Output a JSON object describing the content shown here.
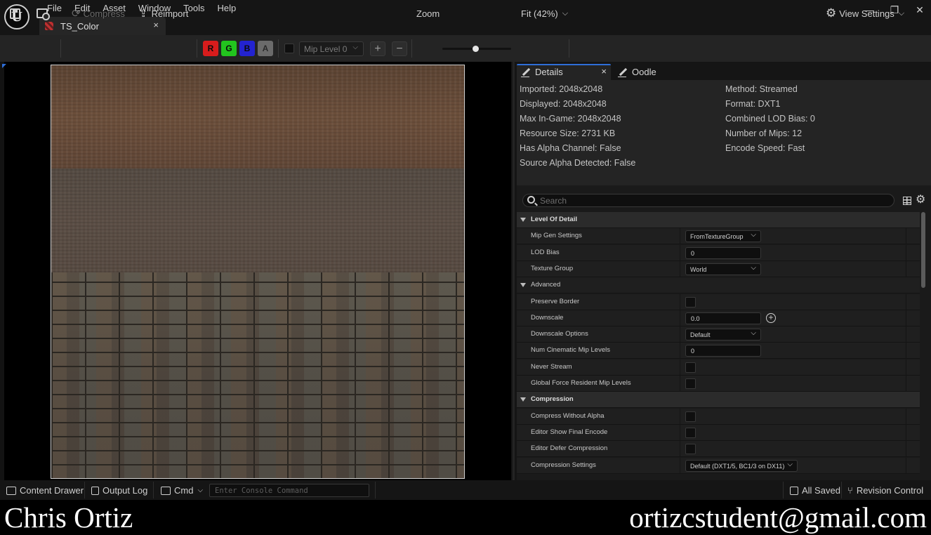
{
  "menu": [
    "File",
    "Edit",
    "Asset",
    "Window",
    "Tools",
    "Help"
  ],
  "document_tab": {
    "title": "TS_Color",
    "close": "×"
  },
  "window_controls": {
    "minimize": "—",
    "restore": "❐",
    "close": "✕"
  },
  "toolbar": {
    "compress_label": "Compress",
    "reimport_label": "Reimport",
    "channels": [
      {
        "label": "R",
        "color": "#d81c1c"
      },
      {
        "label": "G",
        "color": "#22c41e"
      },
      {
        "label": "B",
        "color": "#2323d0"
      },
      {
        "label": "A",
        "color": "#6b6b6b"
      }
    ],
    "mip_level": "Mip Level 0",
    "plus": "+",
    "minus": "−",
    "zoom_label": "Zoom",
    "zoom_value": "Fit (42%)",
    "view_settings_label": "View Settings"
  },
  "details": {
    "tabs": {
      "details": "Details",
      "details_close": "×",
      "oodle": "Oodle"
    },
    "info_left": [
      "Imported: 2048x2048",
      "Displayed: 2048x2048",
      "Max In-Game: 2048x2048",
      "Resource Size: 2731 KB",
      "Has Alpha Channel: False",
      "Source Alpha Detected: False"
    ],
    "info_right": [
      "Method: Streamed",
      "Format: DXT1",
      "Combined LOD Bias: 0",
      "Number of Mips: 12",
      "Encode Speed: Fast"
    ],
    "search_placeholder": "Search",
    "rows": [
      {
        "kind": "cat",
        "label": "Level Of Detail"
      },
      {
        "kind": "prop",
        "label": "Mip Gen Settings",
        "control": "combo",
        "value": "FromTextureGroup"
      },
      {
        "kind": "prop",
        "label": "LOD Bias",
        "control": "num",
        "value": "0"
      },
      {
        "kind": "prop",
        "label": "Texture Group",
        "control": "combo",
        "value": "World"
      },
      {
        "kind": "subcat",
        "label": "Advanced"
      },
      {
        "kind": "prop",
        "label": "Preserve Border",
        "control": "check"
      },
      {
        "kind": "prop",
        "label": "Downscale",
        "control": "num",
        "value": "0.0"
      },
      {
        "kind": "prop",
        "label": "Downscale Options",
        "control": "combo",
        "value": "Default"
      },
      {
        "kind": "prop",
        "label": "Num Cinematic Mip Levels",
        "control": "num",
        "value": "0"
      },
      {
        "kind": "prop",
        "label": "Never Stream",
        "control": "check"
      },
      {
        "kind": "prop",
        "label": "Global Force Resident Mip Levels",
        "control": "check"
      },
      {
        "kind": "cat",
        "label": "Compression"
      },
      {
        "kind": "prop",
        "label": "Compress Without Alpha",
        "control": "check"
      },
      {
        "kind": "prop",
        "label": "Editor Show Final Encode",
        "control": "check"
      },
      {
        "kind": "prop",
        "label": "Editor Defer Compression",
        "control": "check"
      },
      {
        "kind": "prop",
        "label": "Compression Settings",
        "control": "combo",
        "value": "Default (DXT1/5, BC1/3 on DX11)"
      }
    ]
  },
  "statusbar": {
    "content_drawer": "Content Drawer",
    "output_log": "Output Log",
    "cmd": "Cmd",
    "console_placeholder": "Enter Console Command",
    "all_saved": "All Saved",
    "revision_control": "Revision Control"
  },
  "credits": {
    "name": "Chris Ortiz",
    "email": "ortizcstudent@gmail.com"
  }
}
